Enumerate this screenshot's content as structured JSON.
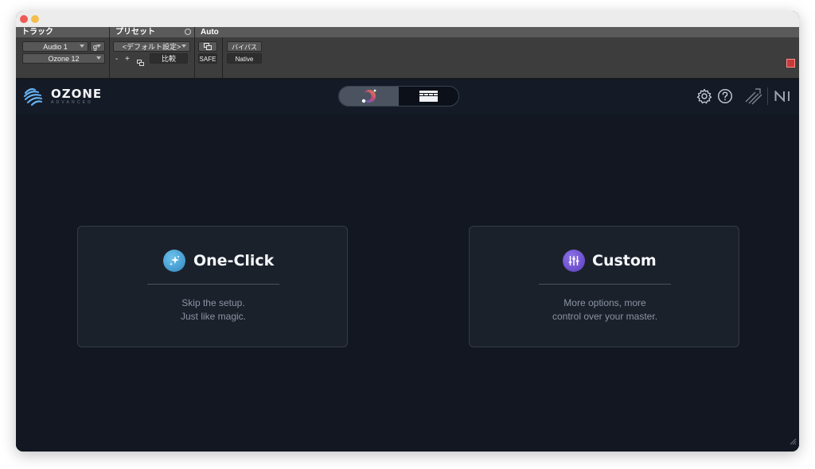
{
  "host": {
    "headers": {
      "track": "トラック",
      "preset": "プリセット",
      "auto": "Auto"
    },
    "track_name": "Audio 1",
    "track_group": "g",
    "plugin_select": "Ozone 12",
    "preset_value": "<デフォルト設定>",
    "preset_minus": "-",
    "preset_plus": "+",
    "compare_label": "比較",
    "safe_label": "SAFE",
    "bypass_label": "バイパス",
    "native_label": "Native"
  },
  "plugin": {
    "logo_name": "OZONE",
    "logo_edition": "ADVANCED",
    "view_toggle": {
      "selected": "assistant-view",
      "options": [
        "assistant-view",
        "module-view"
      ]
    },
    "icons": [
      "settings-gear-icon",
      "help-icon",
      "ozone-signal-icon",
      "ni-logo-icon"
    ]
  },
  "cards": {
    "one_click": {
      "title": "One-Click",
      "line1": "Skip the setup.",
      "line2": "Just like magic.",
      "badge_color": "#4aa3d6"
    },
    "custom": {
      "title": "Custom",
      "line1": "More options, more",
      "line2": "control over your master.",
      "badge_color": "#6f4fd1"
    }
  }
}
